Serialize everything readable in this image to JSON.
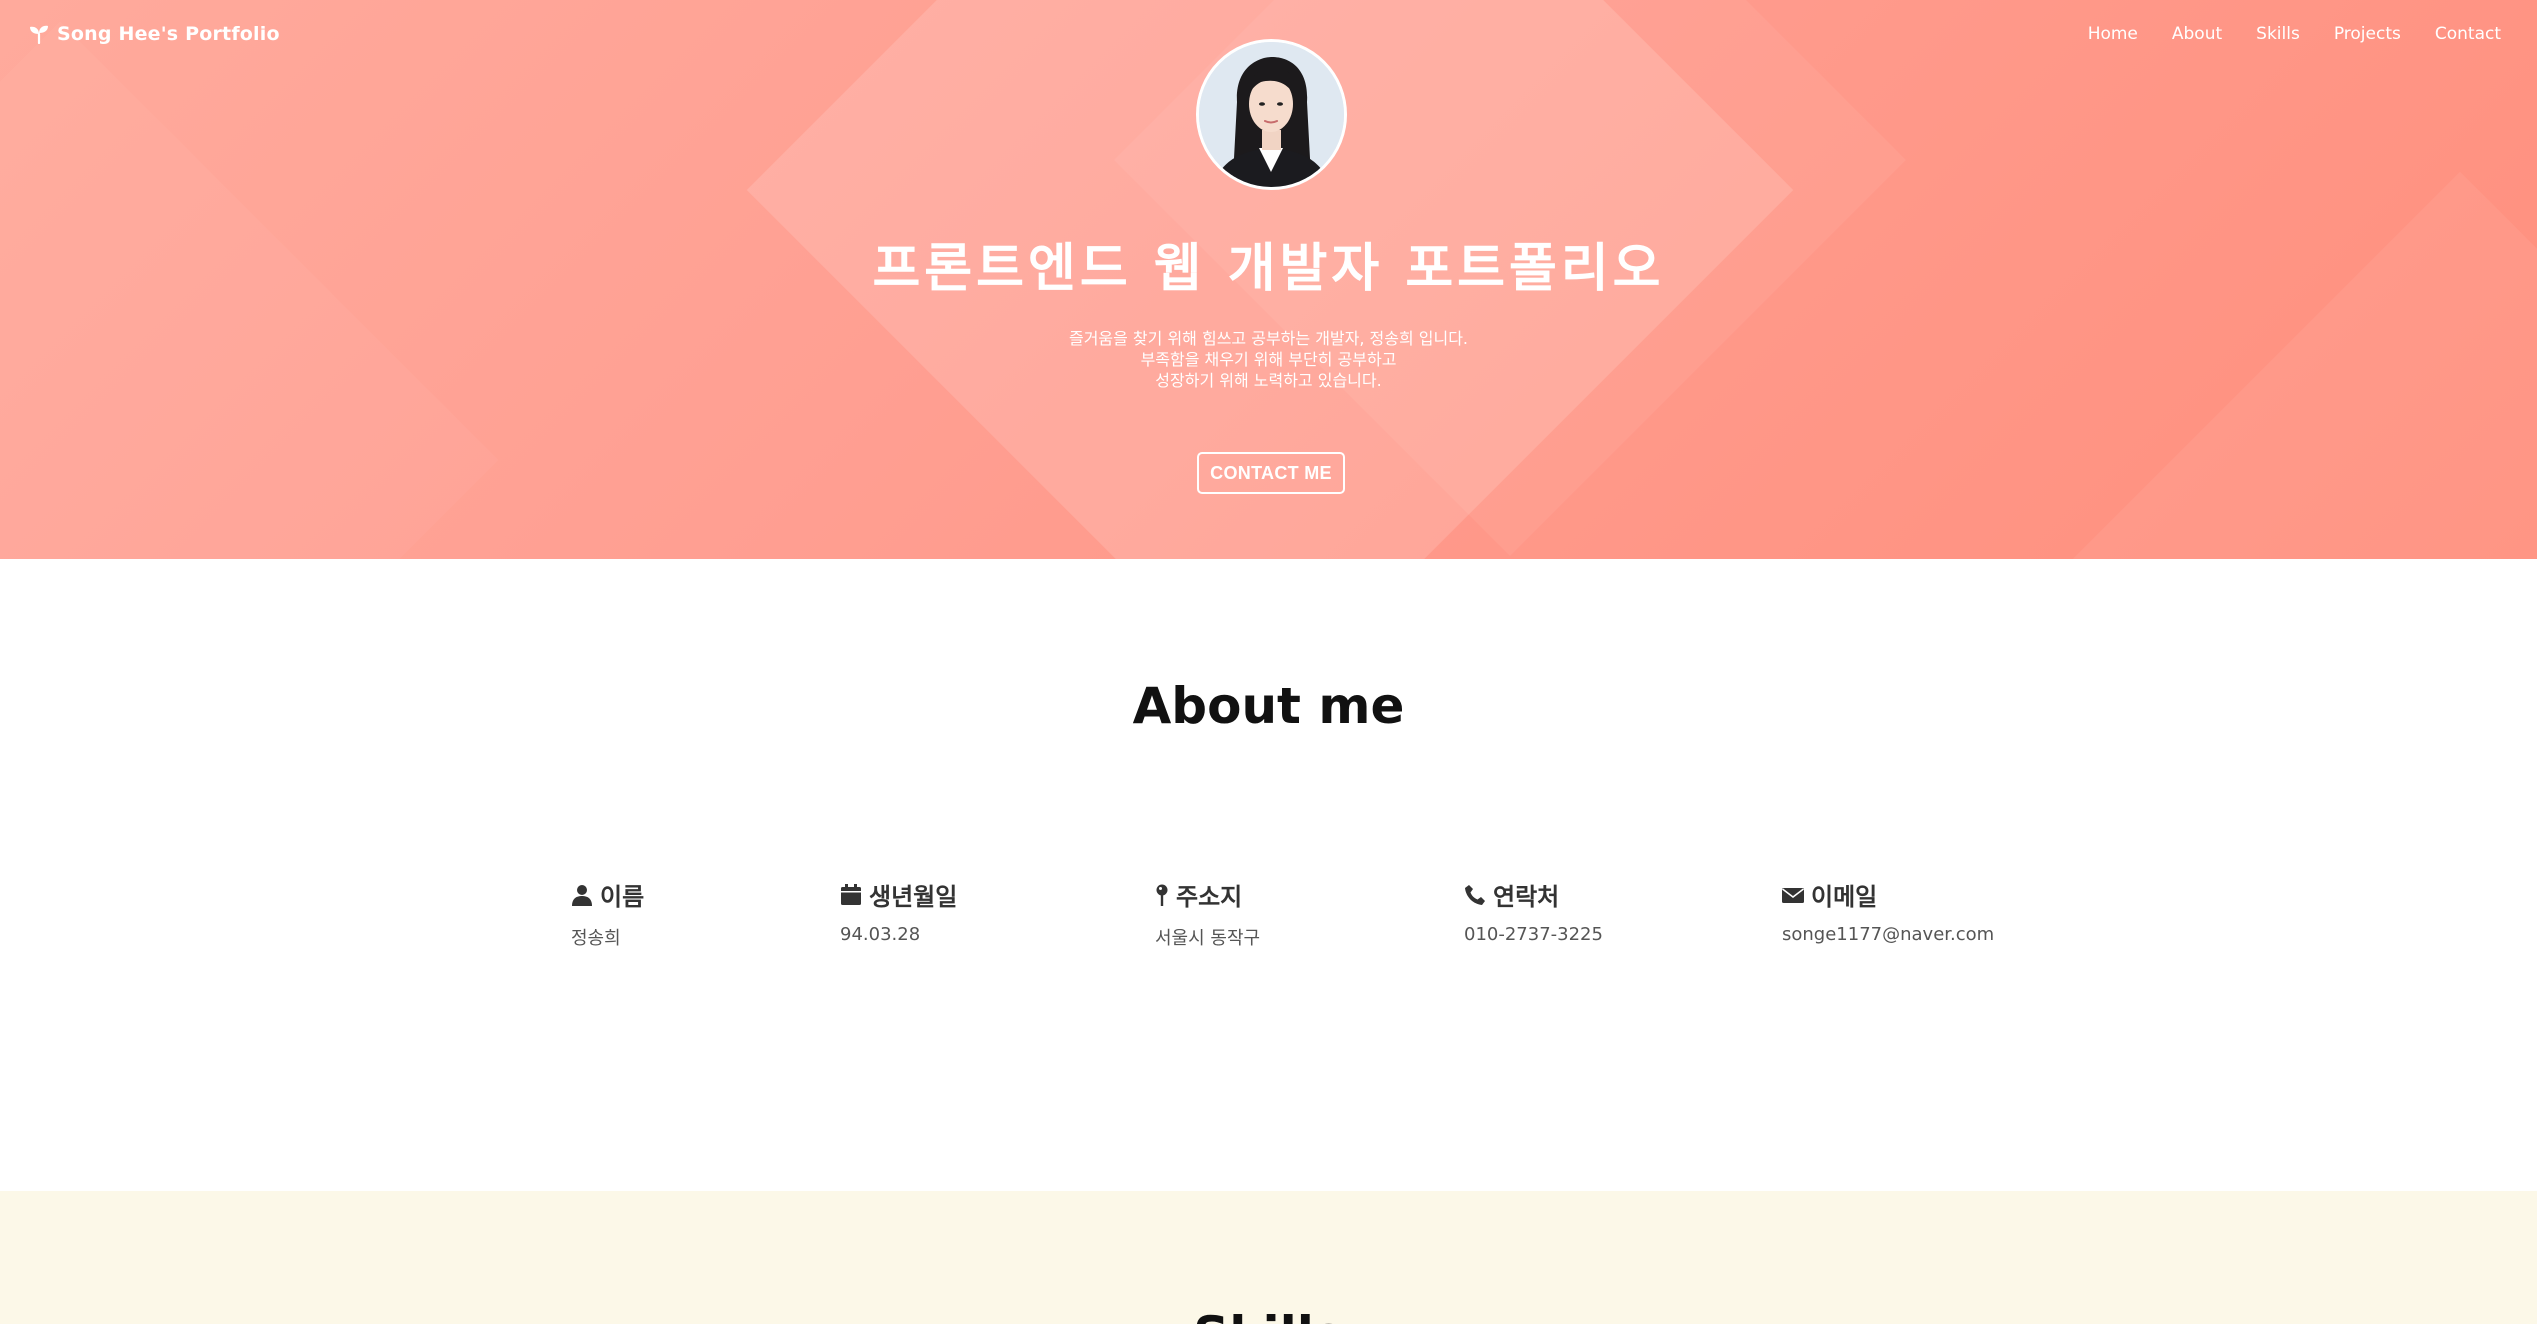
{
  "nav": {
    "brand": "Song Hee's Portfolio",
    "brand_icon": "sprout-icon",
    "links": [
      "Home",
      "About",
      "Skills",
      "Projects",
      "Contact"
    ]
  },
  "hero": {
    "title": "프론트엔드 웹 개발자 포트폴리오",
    "description": [
      "즐거움을 찾기 위해 힘쓰고 공부하는 개발자, 정송희 입니다.",
      "부족함을 채우기 위해 부단히 공부하고",
      "성장하기 위해 노력하고 있습니다."
    ],
    "button": "CONTACT ME",
    "colors": {
      "gradient_start": "#ffaa9c",
      "gradient_end": "#ff8f7d"
    }
  },
  "about": {
    "title": "About me",
    "items": [
      {
        "icon": "user-icon",
        "label": "이름",
        "value": "정송희"
      },
      {
        "icon": "calendar-icon",
        "label": "생년월일",
        "value": "94.03.28"
      },
      {
        "icon": "map-pin-icon",
        "label": "주소지",
        "value": "서울시 동작구"
      },
      {
        "icon": "phone-icon",
        "label": "연락처",
        "value": "010-2737-3225"
      },
      {
        "icon": "envelope-icon",
        "label": "이메일",
        "value": "songe1177@naver.com"
      }
    ]
  },
  "skills": {
    "title": "Skills",
    "background": "#fcf8e8"
  }
}
